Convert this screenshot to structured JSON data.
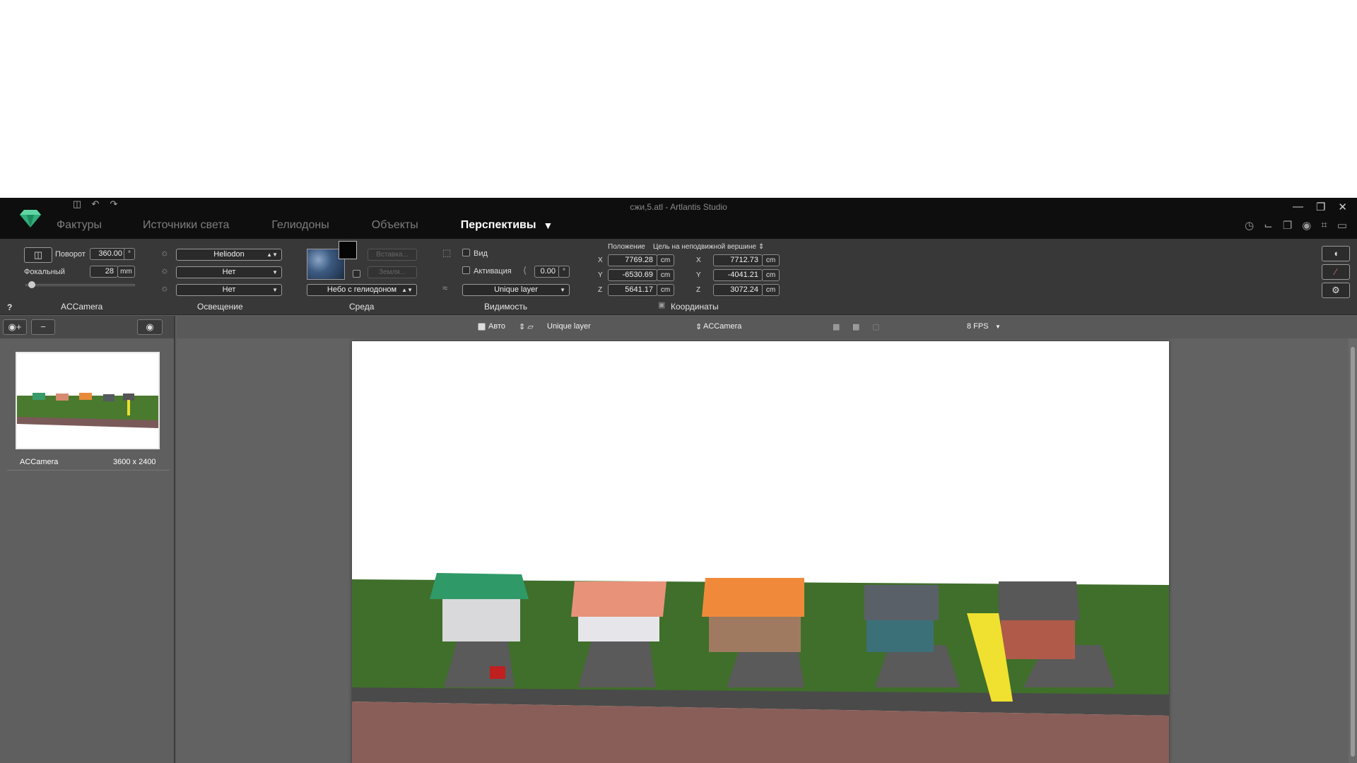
{
  "window": {
    "title": "сжи,5.atl - Artlantis Studio"
  },
  "tabs": [
    {
      "label": "Фактуры"
    },
    {
      "label": "Источники света"
    },
    {
      "label": "Гелиодоны"
    },
    {
      "label": "Объекты"
    },
    {
      "label": "Перспективы"
    }
  ],
  "camera": {
    "rotation_label": "Поворот",
    "rotation_value": "360.00",
    "rotation_unit": "°",
    "focal_label": "Фокальный",
    "focal_value": "28",
    "focal_unit": "mm",
    "section_label": "ACCamera",
    "help": "?"
  },
  "lighting": {
    "heliodon": "Heliodon",
    "light1": "Нет",
    "light2": "Нет",
    "section_label": "Освещение"
  },
  "environment": {
    "insert_label": "Вставка...",
    "ground_label": "Земля...",
    "sky": "Небо с гелиодоном",
    "section_label": "Среда"
  },
  "visibility": {
    "view_label": "Вид",
    "activation_label": "Активация",
    "angle_value": "0.00",
    "angle_unit": "°",
    "layer": "Unique layer",
    "section_label": "Видимость"
  },
  "coordinates": {
    "position_label": "Положение",
    "target_label": "Цель на неподвижной вершине",
    "position": {
      "x": "7769.28",
      "y": "-6530.69",
      "z": "5641.17"
    },
    "target": {
      "x": "7712.73",
      "y": "-4041.21",
      "z": "3072.24"
    },
    "unit": "cm",
    "axis_x": "X",
    "axis_y": "Y",
    "axis_z": "Z",
    "section_label": "Координаты"
  },
  "sidebar": {
    "thumb_name": "ACCamera",
    "thumb_size": "3600 x 2400"
  },
  "viewbar": {
    "auto_label": "Авто",
    "layer": "Unique layer",
    "camera": "ACCamera",
    "fps": "8 FPS"
  },
  "colors": {
    "accent_logo": "#2fae7a",
    "background": "#5e5e5e",
    "toolbar": "#383838"
  }
}
